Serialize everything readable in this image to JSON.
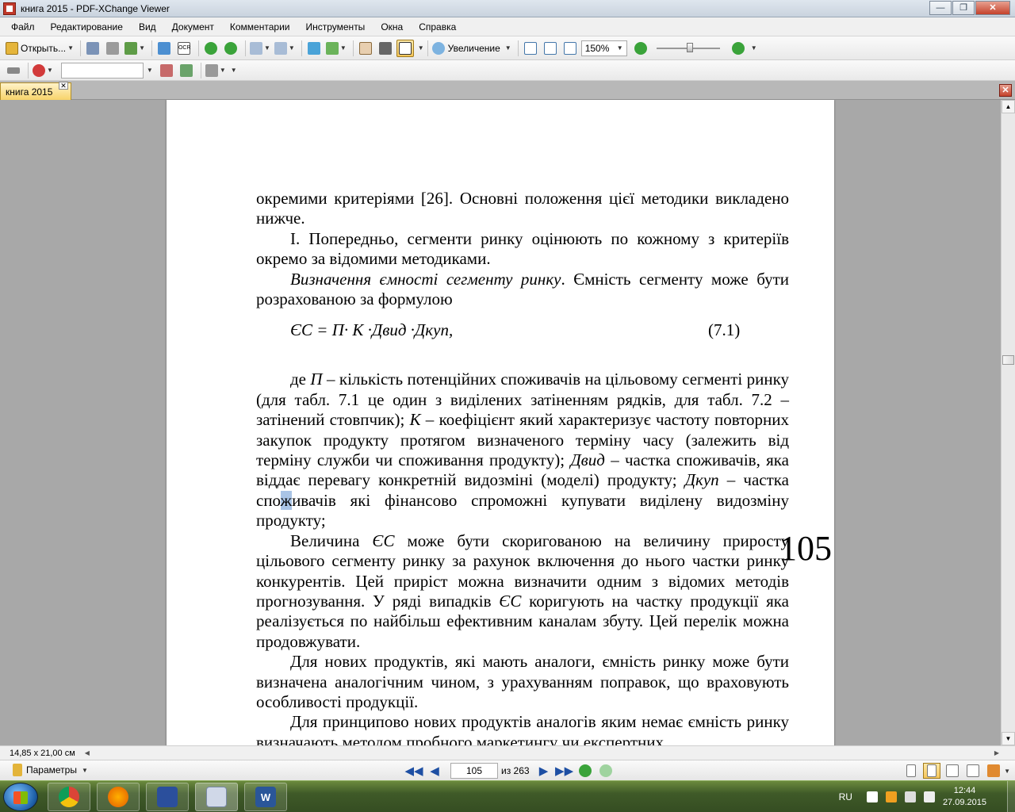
{
  "window": {
    "title": "книга 2015 - PDF-XChange Viewer"
  },
  "menu": [
    "Файл",
    "Редактирование",
    "Вид",
    "Документ",
    "Комментарии",
    "Инструменты",
    "Окна",
    "Справка"
  ],
  "toolbar": {
    "open_label": "Открыть...",
    "zoom_label": "Увеличение",
    "zoom_value": "150%",
    "ocr_label": "OCR"
  },
  "tabs": [
    {
      "label": "книга 2015"
    }
  ],
  "document": {
    "paragraphs": {
      "p1": "окремими критеріями [26]. Основні положення цієї методики викладено нижче.",
      "p2": "І. Попередньо, сегменти ринку оцінюють по кожному з критеріїв окремо за відомими методиками.",
      "p3_italic": "Визначення ємності сегменту ринку",
      "p3_rest": ". Ємність сегменту може бути розрахованою за формулою",
      "formula": "ЄС = П· К ·Двид ·Дкуп,",
      "formula_number": "(7.1)",
      "p4_a": "де ",
      "p4_p": "П",
      "p4_b": " – кількість потенційних споживачів на цільовому сегменті ринку (для табл. 7.1 це один з виділених затіненням рядків, для табл. 7.2 – затінений стовпчик); ",
      "p4_k": "К",
      "p4_c": " – коефіцієнт який характеризує частоту повторних закупок продукту протягом визначеного терміну часу (залежить від терміну служби чи споживання продукту); ",
      "p4_dvyd": "Двид",
      "p4_d": " – частка споживачів, яка віддає перевагу конкретній видозміні (моделі) продукту; ",
      "p4_dkup": "Дкуп",
      "p4_e1": " – частка спо",
      "p4_hl": "ж",
      "p4_e2": "ивачів які фінансово спроможні купувати виділену видозміну продукту;",
      "p5_a": "Величина ",
      "p5_es1": "ЄС",
      "p5_b": " може бути скоригованою на величину приросту цільового сегменту ринку за рахунок включення до нього частки ринку конкурентів. Цей приріст можна визначити одним з відомих методів прогнозування. У ряді випадків ",
      "p5_es2": "ЄС",
      "p5_c": " коригують на частку продукції яка реалізується по найбільш ефективним каналам збуту. Цей перелік можна продовжувати.",
      "p6": "Для нових продуктів, які мають аналоги, ємність ринку може бути визначена аналогічним чином, з урахуванням поправок, що враховують особливості продукції.",
      "p7": "Для принципово нових продуктів аналогів яким немає ємність ринку визначають методом пробного маркетингу чи експертних"
    },
    "page_number_overlay": "105"
  },
  "status": {
    "page_size": "14,85 x 21,00 см",
    "params_label": "Параметры",
    "current_page": "105",
    "page_total": "из 263"
  },
  "taskbar": {
    "lang": "RU",
    "time": "12:44",
    "date": "27.09.2015"
  }
}
